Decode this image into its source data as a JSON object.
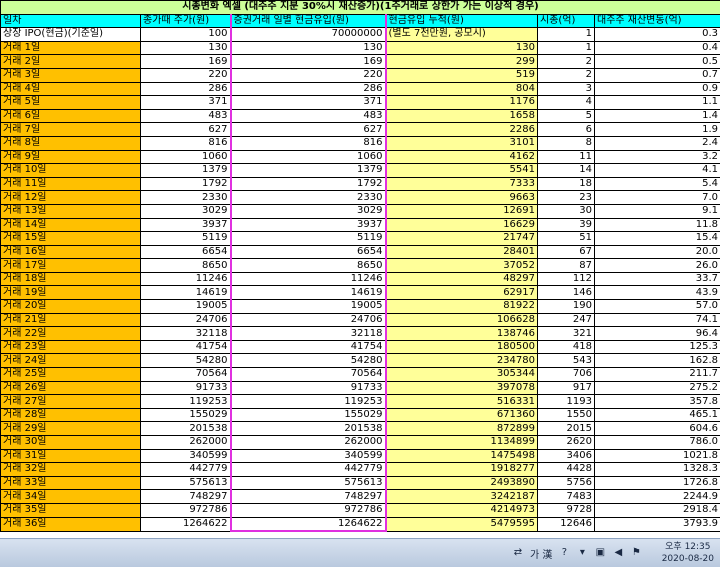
{
  "sheet": {
    "title": "시총변화 엑셀 (대주주 지분 30%시 재산증가)(1주거래로 상한가 가는 이상적 경우)",
    "headers": [
      "일차",
      "종가때 주가(원)",
      "증권거래 일별 현금유입(원)",
      "현금유입 누적(원)",
      "시총(억)",
      "대주주 재산변동(억)"
    ],
    "ipo_row": [
      "상장 IPO(현금)(기준일)",
      "100",
      "70000000",
      "(별도 7천만원, 공모시)",
      "1",
      "0.3"
    ],
    "rows": [
      [
        "거래 1일",
        "130",
        "130",
        "130",
        "1",
        "0.4"
      ],
      [
        "거래 2일",
        "169",
        "169",
        "299",
        "2",
        "0.5"
      ],
      [
        "거래 3일",
        "220",
        "220",
        "519",
        "2",
        "0.7"
      ],
      [
        "거래 4일",
        "286",
        "286",
        "804",
        "3",
        "0.9"
      ],
      [
        "거래 5일",
        "371",
        "371",
        "1176",
        "4",
        "1.1"
      ],
      [
        "거래 6일",
        "483",
        "483",
        "1658",
        "5",
        "1.4"
      ],
      [
        "거래 7일",
        "627",
        "627",
        "2286",
        "6",
        "1.9"
      ],
      [
        "거래 8일",
        "816",
        "816",
        "3101",
        "8",
        "2.4"
      ],
      [
        "거래 9일",
        "1060",
        "1060",
        "4162",
        "11",
        "3.2"
      ],
      [
        "거래 10일",
        "1379",
        "1379",
        "5541",
        "14",
        "4.1"
      ],
      [
        "거래 11일",
        "1792",
        "1792",
        "7333",
        "18",
        "5.4"
      ],
      [
        "거래 12일",
        "2330",
        "2330",
        "9663",
        "23",
        "7.0"
      ],
      [
        "거래 13일",
        "3029",
        "3029",
        "12691",
        "30",
        "9.1"
      ],
      [
        "거래 14일",
        "3937",
        "3937",
        "16629",
        "39",
        "11.8"
      ],
      [
        "거래 15일",
        "5119",
        "5119",
        "21747",
        "51",
        "15.4"
      ],
      [
        "거래 16일",
        "6654",
        "6654",
        "28401",
        "67",
        "20.0"
      ],
      [
        "거래 17일",
        "8650",
        "8650",
        "37052",
        "87",
        "26.0"
      ],
      [
        "거래 18일",
        "11246",
        "11246",
        "48297",
        "112",
        "33.7"
      ],
      [
        "거래 19일",
        "14619",
        "14619",
        "62917",
        "146",
        "43.9"
      ],
      [
        "거래 20일",
        "19005",
        "19005",
        "81922",
        "190",
        "57.0"
      ],
      [
        "거래 21일",
        "24706",
        "24706",
        "106628",
        "247",
        "74.1"
      ],
      [
        "거래 22일",
        "32118",
        "32118",
        "138746",
        "321",
        "96.4"
      ],
      [
        "거래 23일",
        "41754",
        "41754",
        "180500",
        "418",
        "125.3"
      ],
      [
        "거래 24일",
        "54280",
        "54280",
        "234780",
        "543",
        "162.8"
      ],
      [
        "거래 25일",
        "70564",
        "70564",
        "305344",
        "706",
        "211.7"
      ],
      [
        "거래 26일",
        "91733",
        "91733",
        "397078",
        "917",
        "275.2"
      ],
      [
        "거래 27일",
        "119253",
        "119253",
        "516331",
        "1193",
        "357.8"
      ],
      [
        "거래 28일",
        "155029",
        "155029",
        "671360",
        "1550",
        "465.1"
      ],
      [
        "거래 29일",
        "201538",
        "201538",
        "872899",
        "2015",
        "604.6"
      ],
      [
        "거래 30일",
        "262000",
        "262000",
        "1134899",
        "2620",
        "786.0"
      ],
      [
        "거래 31일",
        "340599",
        "340599",
        "1475498",
        "3406",
        "1021.8"
      ],
      [
        "거래 32일",
        "442779",
        "442779",
        "1918277",
        "4428",
        "1328.3"
      ],
      [
        "거래 33일",
        "575613",
        "575613",
        "2493890",
        "5756",
        "1726.8"
      ],
      [
        "거래 34일",
        "748297",
        "748297",
        "3242187",
        "7483",
        "2244.9"
      ],
      [
        "거래 35일",
        "972786",
        "972786",
        "4214973",
        "9728",
        "2918.4"
      ],
      [
        "거래 36일",
        "1264622",
        "1264622",
        "5479595",
        "12646",
        "3793.9"
      ]
    ]
  },
  "taskbar": {
    "ime_label": "가 漢",
    "ime_icon": "language-bar-icon",
    "help_icon": "help-icon",
    "clock_time": "오후 12:35",
    "clock_date": "2020-08-20"
  }
}
